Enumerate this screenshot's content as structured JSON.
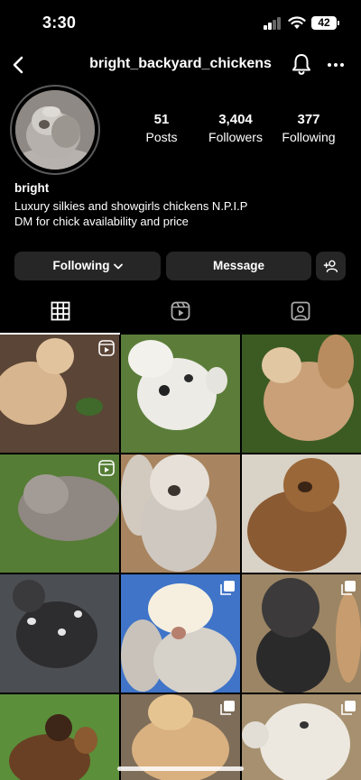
{
  "status_bar": {
    "time": "3:30",
    "battery": "42"
  },
  "header": {
    "username": "bright_backyard_chickens",
    "icons": {
      "back": "chevron-left-icon",
      "notifications": "bell-icon",
      "more": "more-horizontal-icon"
    }
  },
  "profile": {
    "stats": [
      {
        "value": "51",
        "label": "Posts"
      },
      {
        "value": "3,404",
        "label": "Followers"
      },
      {
        "value": "377",
        "label": "Following"
      }
    ],
    "name": "bright",
    "bio_lines": [
      "Luxury silkies and showgirls chickens N.P.I.P",
      "DM for chick availability and price"
    ]
  },
  "actions": {
    "following_label": "Following",
    "message_label": "Message",
    "add_user_icon": "add-user-icon"
  },
  "tabs": [
    {
      "icon": "grid-icon",
      "active": true
    },
    {
      "icon": "reels-icon",
      "active": false
    },
    {
      "icon": "tagged-icon",
      "active": false
    }
  ],
  "grid": [
    {
      "subject": "buff silkie chicken on soil",
      "badge": "reel-icon"
    },
    {
      "subject": "white and black splash silkie on grass",
      "badge": ""
    },
    {
      "subject": "buff frizzle silkie by fence",
      "badge": ""
    },
    {
      "subject": "grey fluffy silkie on grass",
      "badge": "reel-icon"
    },
    {
      "subject": "grey splash showgirl chicken",
      "badge": ""
    },
    {
      "subject": "partridge brown silkie",
      "badge": ""
    },
    {
      "subject": "black and white splash silkie on pavement",
      "badge": ""
    },
    {
      "subject": "white crested silkie against sky",
      "badge": "multi-photo-icon"
    },
    {
      "subject": "dark grey silkie in pen",
      "badge": "multi-photo-icon"
    },
    {
      "subject": "two partridge chicks on grass",
      "badge": ""
    },
    {
      "subject": "buff silkie chicks",
      "badge": "multi-photo-icon"
    },
    {
      "subject": "white silkie chicks group",
      "badge": "multi-photo-icon"
    }
  ]
}
